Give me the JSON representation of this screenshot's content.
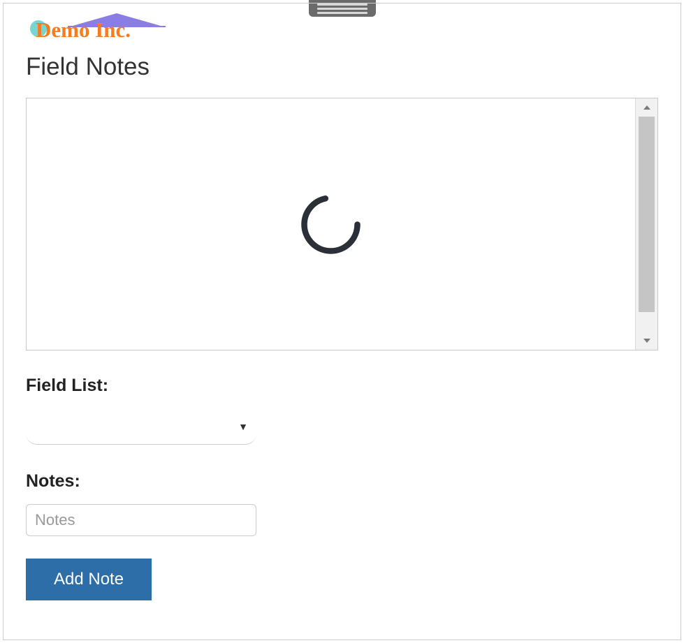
{
  "logo": {
    "text": "Demo Inc."
  },
  "page": {
    "title": "Field Notes"
  },
  "form": {
    "field_list_label": "Field List:",
    "field_list_selected": "",
    "notes_label": "Notes:",
    "notes_placeholder": "Notes",
    "notes_value": "",
    "add_button_label": "Add Note"
  }
}
